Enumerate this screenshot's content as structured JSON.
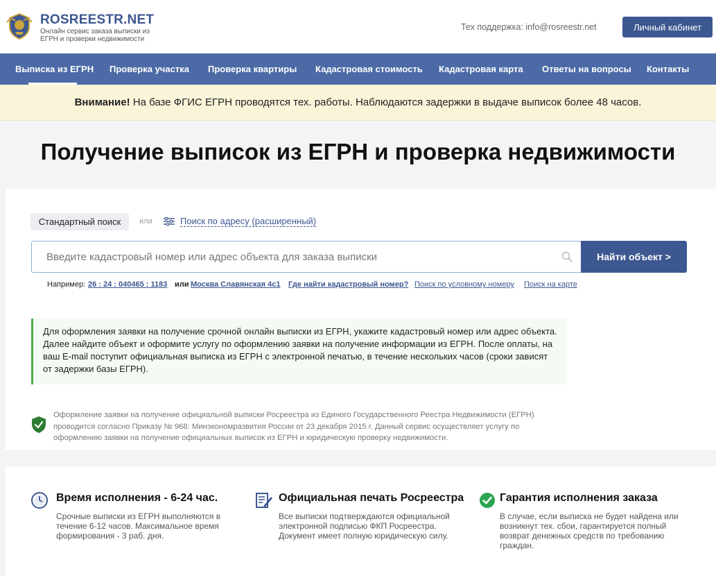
{
  "header": {
    "logo_title": "ROSREESTR.NET",
    "logo_subtitle": "Онлайн сервис заказа выписки из ЕГРН и проверки недвижимости",
    "support": "Тех поддержка: info@rosreestr.net",
    "cabinet_label": "Личный кабинет"
  },
  "nav": {
    "items": [
      {
        "label": "Выписка из ЕГРН",
        "active": true
      },
      {
        "label": "Проверка участка"
      },
      {
        "label": "Проверка квартиры"
      },
      {
        "label": "Кадастровая стоимость"
      },
      {
        "label": "Кадастровая карта"
      },
      {
        "label": "Ответы на вопросы"
      },
      {
        "label": "Контакты"
      }
    ]
  },
  "warning": {
    "bold": "Внимание!",
    "text": " На базе ФГИС ЕГРН проводятся тех. работы. Наблюдаются задержки в выдаче выписок более 48 часов."
  },
  "page_title": "Получение выписок из ЕГРН и проверка недвижимости",
  "search": {
    "standard_label": "Стандартный поиск",
    "or_label": "или",
    "advanced_label": "Поиск по адресу (расширенный)",
    "placeholder": "Введите кадастровый номер или адрес объекта для заказа выписки",
    "button_label": "Найти объект >",
    "examples_label": "Например:",
    "example_cadastral": "26 : 24 : 040465 : 1183",
    "examples_or": "или",
    "example_address": "Москва Славянская 4с1",
    "where_find": "Где найти кадастровый номер?",
    "conditional_number": "Поиск по условному номеру",
    "map_search": "Поиск на карте"
  },
  "info_text": "Для оформления заявки на получение срочной онлайн выписки из ЕГРН, укажите кадастровый номер или адрес объекта. Далее найдите объект и оформите услугу по оформлению заявки на получение информации из ЕГРН. После оплаты, на ваш E-mail поступит официальная выписка из ЕГРН с электронной печатью, в течение нескольких часов (сроки зависят от задержки базы ЕГРН).",
  "legal_text": "Оформление заявки на получение официальной выписки Росреестра из Единого Государственного Реестра Недвижимости (ЕГРН) проводится согласно Приказу № 968: Минэкономразвития России от 23 декабря 2015 г. Данный сервис осуществляет услугу по оформлению заявки на получение официальных выписок из ЕГРН и юридическую проверку недвижимости.",
  "features": [
    {
      "icon": "clock-icon",
      "title": "Время исполнения - 6-24 час.",
      "text": "Срочные выписки из ЕГРН выполняются в течение 6-12 часов. Максимальное время формирования - 3 раб. дня."
    },
    {
      "icon": "document-edit-icon",
      "title": "Официальная печать Росреестра",
      "text": "Все выписки подтверждаются официальной электронной подписью ФКП Росреестра. Документ имеет полную юридическую силу."
    },
    {
      "icon": "check-circle-icon",
      "title": "Гарантия исполнения заказа",
      "text": "В случае, если выписка не будет найдена или возникнут тех. сбои, гарантируется полный возврат денежных средств по требованию граждан."
    }
  ],
  "colors": {
    "brand": "#3d5791",
    "nav_bg": "#4b6aa6",
    "warning_bg": "#faf4d9",
    "success": "#4caf50"
  }
}
